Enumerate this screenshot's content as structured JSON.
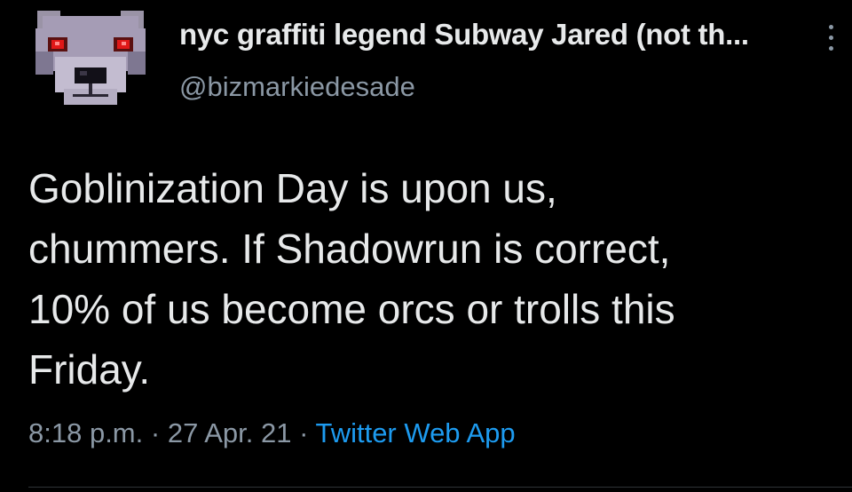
{
  "tweet": {
    "display_name": "nyc graffiti legend Subway Jared (not th...",
    "handle": "@bizmarkiedesade",
    "text": "Goblinization Day is upon us,\nchummers. If Shadowrun is correct,\n10% of us become orcs or trolls this\nFriday.",
    "time": "8:18 p.m.",
    "date": "27 Apr. 21",
    "separator": "·",
    "source_app": "Twitter Web App",
    "avatar_icon": "pixel-dog-red-eyes-icon",
    "more_icon": "more-options-vertical-icon"
  },
  "colors": {
    "background": "#000000",
    "primary_text": "#e7e9ea",
    "secondary_text": "#8b98a5",
    "link": "#1d9bf0"
  }
}
